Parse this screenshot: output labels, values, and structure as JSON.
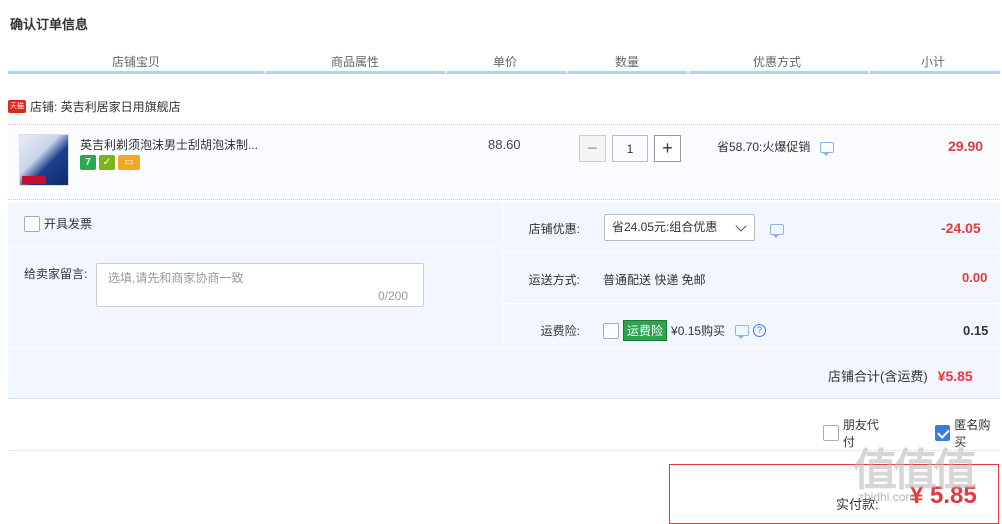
{
  "page_title": "确认订单信息",
  "columns": [
    "店铺宝贝",
    "商品属性",
    "单价",
    "数量",
    "优惠方式",
    "小计"
  ],
  "shop": {
    "badge": "天猫",
    "name": "店铺: 英吉利居家日用旗舰店"
  },
  "item": {
    "title": "英吉利剃须泡沫男士刮胡泡沫制...",
    "service_icons": [
      "seven-day-return-icon",
      "shield-icon",
      "credit-card-icon"
    ],
    "seven_label": "7",
    "price": "88.60",
    "quantity": "1",
    "minus": "−",
    "plus": "+",
    "promo": "省58.70:火爆促销",
    "subtotal": "29.90"
  },
  "options": {
    "invoice_label": "开具发票",
    "message_label": "给卖家留言:",
    "message_placeholder": "选填,请先和商家协商一致",
    "message_count": "0/200",
    "shop_discount_label": "店铺优惠:",
    "shop_discount_selected": "省24.05元:组合优惠",
    "shop_discount_amount": "-24.05",
    "shipping_label": "运送方式:",
    "shipping_value": "普通配送 快递 免邮",
    "shipping_amount": "0.00",
    "insurance_label": "运费险:",
    "insurance_badge": "运费险",
    "insurance_price_text": "¥0.15购买",
    "insurance_help": "?",
    "insurance_amount": "0.15"
  },
  "shop_total": {
    "label": "店铺合计(含运费)",
    "value": "¥5.85"
  },
  "bottom": {
    "friend_pay_label": "朋友代付",
    "anonymous_label": "匿名购买",
    "anonymous_checked": true
  },
  "payment": {
    "label": "实付款:",
    "value": "¥ 5.85"
  },
  "watermark": {
    "text": "值值值",
    "url": "zhidhi.com"
  },
  "colors": {
    "accent": "#e4393c",
    "header_line": "#b2d1ff",
    "panel_bg": "#f2f7ff"
  }
}
